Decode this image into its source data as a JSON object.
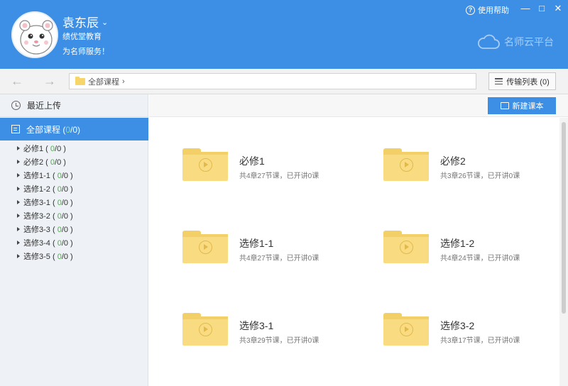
{
  "header": {
    "user_name": "袁东辰",
    "org": "绩优堂教育",
    "slogan": "为名师服务！",
    "help": "使用帮助",
    "minimize": "—",
    "maximize": "□",
    "close": "✕",
    "brand": "名师云平台"
  },
  "toolbar": {
    "back": "←",
    "forward": "→",
    "breadcrumb": "全部课程",
    "breadcrumb_sep": "›",
    "transfer_label": "传输列表 (0)"
  },
  "sidebar": {
    "recent_label": "最近上传",
    "all_courses_label": "全部课程 (",
    "all_courses_count": "0",
    "all_courses_total": "/0)",
    "items": [
      {
        "name": "必修1",
        "done": "0",
        "total": "/0 )"
      },
      {
        "name": "必修2",
        "done": "0",
        "total": "/0 )"
      },
      {
        "name": "选修1-1",
        "done": "0",
        "total": "/0 )"
      },
      {
        "name": "选修1-2",
        "done": "0",
        "total": "/0 )"
      },
      {
        "name": "选修3-1",
        "done": "0",
        "total": "/0 )"
      },
      {
        "name": "选修3-2",
        "done": "0",
        "total": "/0 )"
      },
      {
        "name": "选修3-3",
        "done": "0",
        "total": "/0 )"
      },
      {
        "name": "选修3-4",
        "done": "0",
        "total": "/0 )"
      },
      {
        "name": "选修3-5",
        "done": "0",
        "total": "/0 )"
      }
    ]
  },
  "main": {
    "new_course_label": "新建课本",
    "courses": [
      {
        "title": "必修1",
        "desc": "共4章27节课，已开讲0课"
      },
      {
        "title": "必修2",
        "desc": "共3章26节课，已开讲0课"
      },
      {
        "title": "选修1-1",
        "desc": "共4章27节课，已开讲0课"
      },
      {
        "title": "选修1-2",
        "desc": "共4章24节课，已开讲0课"
      },
      {
        "title": "选修3-1",
        "desc": "共3章29节课，已开讲0课"
      },
      {
        "title": "选修3-2",
        "desc": "共3章17节课，已开讲0课"
      }
    ]
  },
  "colors": {
    "header_blue": "#3d8ee5",
    "folder_yellow": "#f9dc82",
    "sidebar_bg": "#eef1f5"
  }
}
